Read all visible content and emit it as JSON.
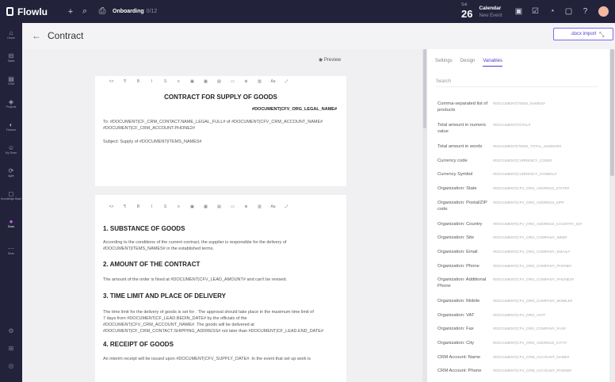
{
  "topbar": {
    "app_name": "Flowlu",
    "add_icon": "+",
    "search_icon": "search",
    "crumb_title": "Onboarding",
    "crumb_count": "0/12",
    "date_day": "Sat",
    "date_num": "26",
    "calendar_title": "Calendar",
    "calendar_sub": "New Event"
  },
  "sidebar": {
    "items": [
      {
        "icon": "home-icon",
        "label": "Home"
      },
      {
        "icon": "sales-icon",
        "label": "Sales"
      },
      {
        "icon": "crm-icon",
        "label": "CRM"
      },
      {
        "icon": "projects-icon",
        "label": "Projects"
      },
      {
        "icon": "finance-icon",
        "label": "Finance"
      },
      {
        "icon": "team-icon",
        "label": "My Team"
      },
      {
        "icon": "agile-icon",
        "label": "Agile"
      },
      {
        "icon": "knowledge-icon",
        "label": "Knowledge Base"
      },
      {
        "icon": "docs-icon",
        "label": "Docs"
      },
      {
        "icon": "more-icon",
        "label": "More"
      }
    ]
  },
  "page": {
    "title": "Contract",
    "import_label": ".docx import",
    "preview_label": "Preview"
  },
  "doc": {
    "title": "CONTRACT FOR SUPPLY OF GOODS",
    "org": "#DOCUMENT|CFV_ORG_LEGAL_NAME#",
    "to_line1": "To: #DOCUMENT|CF_CRM_CONTACT.NAME_LEGAL_FULL# of #DOCUMENT|CFV_CRM_ACCOUNT_NAME#",
    "to_line2": "#DOCUMENT|CF_CRM_ACCOUNT.PHONE2#",
    "subject": "Subject: Supply of #DOCUMENT|ITEMS_NAMES#",
    "h1": "1. SUBSTANCE OF GOODS",
    "p1a": "According to the conditions of the current contract, the supplier is responsible for the delivery of",
    "p1b": "#DOCUMENT|ITEMS_NAMES# in the established terms.",
    "h2": "2. AMOUNT OF THE CONTRACT",
    "p2": "The amount of the order is fixed at #DOCUMENT|CFV_LEAD_AMOUNT# and can't be revised.",
    "h3": "3. TIME LIMIT AND PLACE OF DELIVERY",
    "p3a": "The time limit for the delivery of goods is set for . The approval should take place in the maximum time limit of",
    "p3b": "7 days from #DOCUMENT|CF_LEAD.BEDIN_DATE# by the officials of the",
    "p3c": "#DOCUMENT|CFV_CRM_ACCOUNT_NAME#. The goods will be delivered at",
    "p3d": "#DOCUMENT|CF_CRM_CONTACT.SHIPPING_ADDRESS# not later than #DOCUMENT|CF_LEAD.END_DATE#",
    "h4": "4. RECEIPT OF GOODS",
    "p4": "An interim receipt will be issued upon #DOCUMENT|CFV_SUPPLY_DATE#. In the event that set up work is"
  },
  "toolbar": [
    "<>",
    "¶",
    "B",
    "I",
    "S",
    "≡",
    "▣",
    "▦",
    "▤",
    "▭",
    "⊕",
    "▥",
    "Aa",
    "⤢"
  ],
  "panel": {
    "tabs": [
      "Settings",
      "Design",
      "Variables"
    ],
    "search_placeholder": "Search",
    "variables": [
      {
        "k": "Comma-separated list of products",
        "v": "#DOCUMENT|ITEMS_NAMES#"
      },
      {
        "k": "Total amount in numeric value",
        "v": "#DOCUMENT|TOTAL#"
      },
      {
        "k": "Total amount in words",
        "v": "#DOCUMENT|ITEMS_TOTAL_SUMSHR#"
      },
      {
        "k": "Currency code",
        "v": "#DOCUMENT|CURRENCY_CODE#"
      },
      {
        "k": "Currency Symbol",
        "v": "#DOCUMENT|CURRENCY_SYMBOL#"
      },
      {
        "k": "Organization: State",
        "v": "#DOCUMENT|CFV_ORG_ADDRESS_STATE#"
      },
      {
        "k": "Organization: Postal/ZIP code",
        "v": "#DOCUMENT|CFV_ORG_ADDRESS_ZIP#"
      },
      {
        "k": "Organization: Country",
        "v": "#DOCUMENT|CFV_ORG_ADDRESS_COUNTRY_ID#"
      },
      {
        "k": "Organization: Site",
        "v": "#DOCUMENT|CFV_ORG_COMPANY_WEB#"
      },
      {
        "k": "Organization: Email",
        "v": "#DOCUMENT|CFV_ORG_COMPANY_EMAIL#"
      },
      {
        "k": "Organization: Phone",
        "v": "#DOCUMENT|CFV_ORG_COMPANY_PHONE#"
      },
      {
        "k": "Organization: Additional Phone",
        "v": "#DOCUMENT|CFV_ORG_COMPANY_PHONE2#"
      },
      {
        "k": "Organization: Mobile",
        "v": "#DOCUMENT|CFV_ORG_COMPANY_MOBILE#"
      },
      {
        "k": "Organization: VAT",
        "v": "#DOCUMENT|CFV_ORG_VAT#"
      },
      {
        "k": "Organization: Fax",
        "v": "#DOCUMENT|CFV_ORG_COMPANY_FAX#"
      },
      {
        "k": "Organization: City",
        "v": "#DOCUMENT|CFV_ORG_ADDRESS_CITY#"
      },
      {
        "k": "CRM Account: Name",
        "v": "#DOCUMENT|CFV_CRM_ACCOUNT_NAME#"
      },
      {
        "k": "CRM Account: Phone",
        "v": "#DOCUMENT|CFV_CRM_ACCOUNT_PHONE#"
      }
    ]
  },
  "colors": {
    "accent": "#4b3fcf",
    "topbar": "#22233a",
    "docs_active": "#c266f0"
  }
}
